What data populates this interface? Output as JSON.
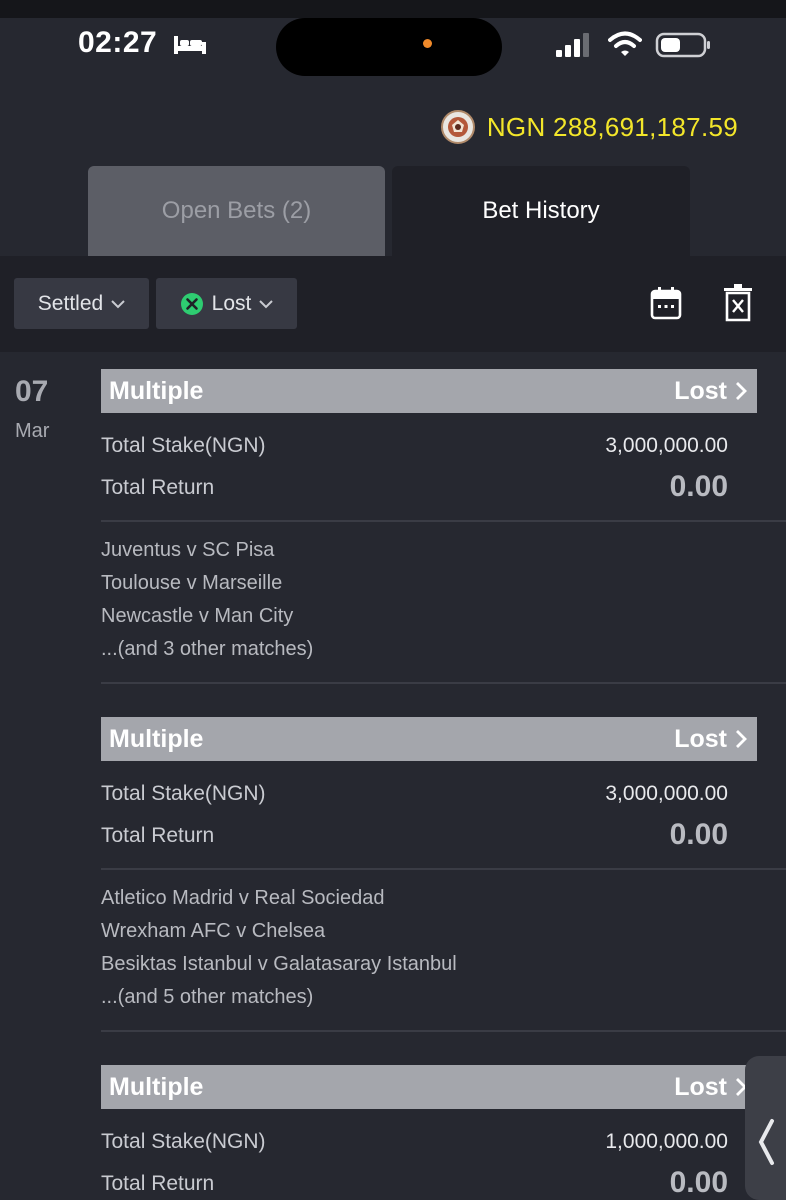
{
  "status_bar": {
    "time": "02:27"
  },
  "balance": {
    "text": "NGN 288,691,187.59"
  },
  "tabs": [
    {
      "label": "Open Bets (2)",
      "active": false
    },
    {
      "label": "Bet History",
      "active": true
    }
  ],
  "filters": {
    "status": "Settled",
    "result": "Lost"
  },
  "date": {
    "day": "07",
    "month": "Mar"
  },
  "bets": [
    {
      "type": "Multiple",
      "status": "Lost",
      "stake_label": "Total Stake(NGN)",
      "stake": "3,000,000.00",
      "return_label": "Total Return",
      "return": "0.00",
      "matches": [
        "Juventus v SC Pisa",
        "Toulouse v Marseille",
        "Newcastle v Man City",
        "...(and 3 other matches)"
      ]
    },
    {
      "type": "Multiple",
      "status": "Lost",
      "stake_label": "Total Stake(NGN)",
      "stake": "3,000,000.00",
      "return_label": "Total Return",
      "return": "0.00",
      "matches": [
        "Atletico Madrid v Real Sociedad",
        "Wrexham AFC v Chelsea",
        "Besiktas Istanbul v Galatasaray Istanbul",
        "...(and 5 other matches)"
      ]
    },
    {
      "type": "Multiple",
      "status": "Lost",
      "stake_label": "Total Stake(NGN)",
      "stake": "1,000,000.00",
      "return_label": "Total Return",
      "return": "0.00"
    }
  ],
  "colors": {
    "background": "#262830",
    "balance": "#f3e62a",
    "header_bar": "#a4a6ac",
    "lost_icon": "#2ecc71"
  }
}
